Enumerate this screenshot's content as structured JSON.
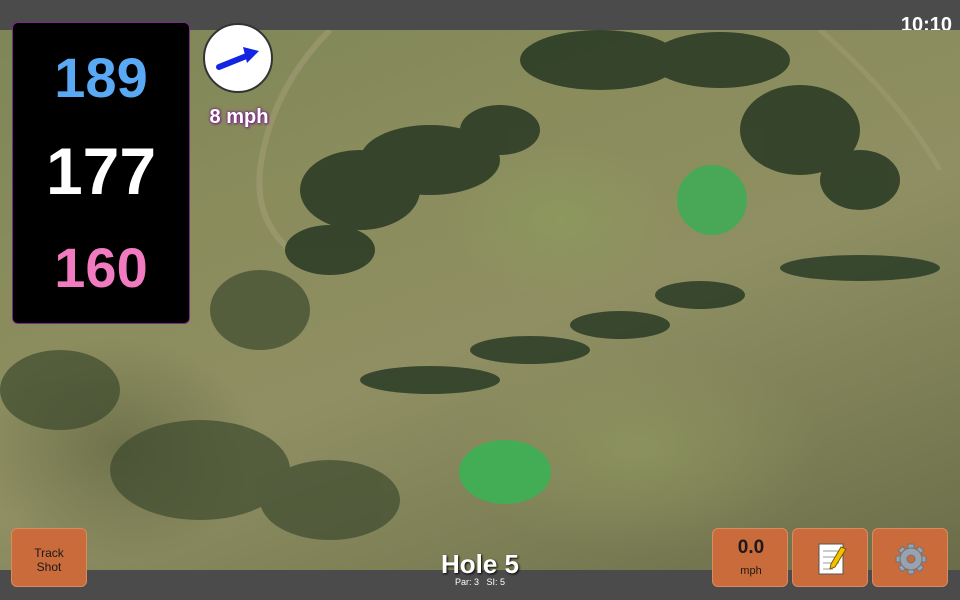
{
  "status": {
    "time": "10:10"
  },
  "distances": {
    "back": "189",
    "middle": "177",
    "front": "160"
  },
  "wind": {
    "speed_label": "8 mph",
    "direction_icon": "arrow-icon"
  },
  "buttons": {
    "track_shot": [
      "Track",
      "Shot"
    ],
    "speed_value": "0.0",
    "speed_unit": "mph",
    "notes_icon": "notepad-icon",
    "settings_icon": "gear-icon"
  },
  "hole": {
    "title": "Hole 5",
    "par_label": "Par: 3",
    "si_label": "SI: 5"
  },
  "colors": {
    "back": "#5aa9f5",
    "middle": "#ffffff",
    "front": "#f27ac0",
    "button": "#ca6b3b",
    "accent": "#7c2a88"
  }
}
